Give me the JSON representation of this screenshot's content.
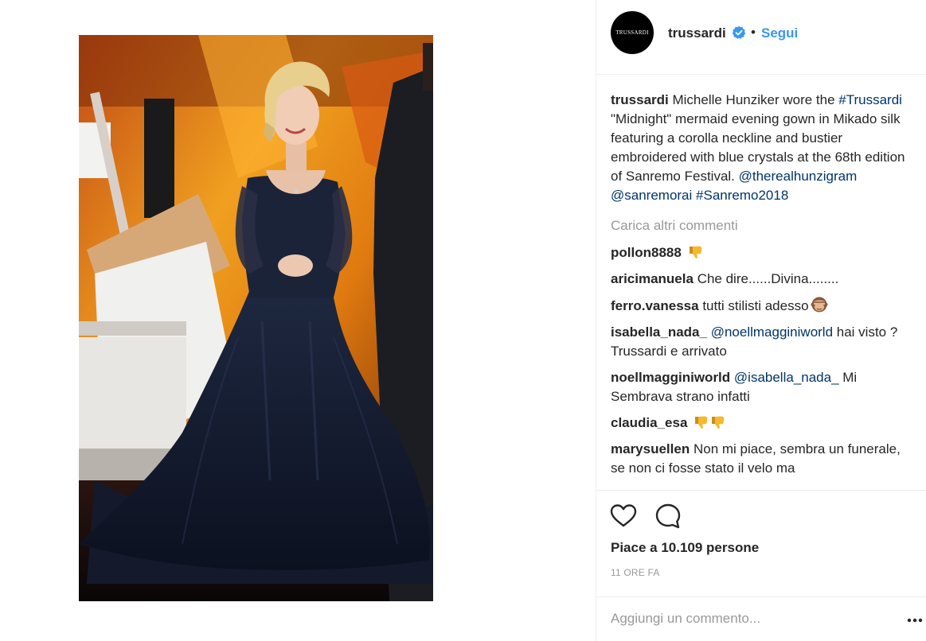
{
  "post": {
    "username": "trussardi",
    "avatar_text": "TRUSSARDI",
    "follow_label": "Segui",
    "separator": "•",
    "caption": {
      "username": "trussardi",
      "text1": " Michelle Hunziker wore the ",
      "hashtag1": "#Trussardi",
      "text2": " \"Midnight\" mermaid evening gown in Mikado silk featuring a corolla neckline and bustier embroidered with blue crystals at the 68th edition of Sanremo Festival. ",
      "mention1": "@therealhunzigram",
      "text3": " ",
      "mention2": "@sanremorai",
      "text4": " ",
      "hashtag2": "#Sanremo2018"
    },
    "load_more": "Carica altri commenti",
    "comments": [
      {
        "user": "pollon8888",
        "text": ""
      },
      {
        "user": "aricimanuela",
        "text": "Che dire......Divina........"
      },
      {
        "user": "ferro.vanessa",
        "text": "tutti stilisti adesso"
      },
      {
        "user": "isabella_nada_",
        "mention": "@noellmagginiworld",
        "text": " hai visto ? Trussardi e arrivato"
      },
      {
        "user": "noellmagginiworld",
        "mention": "@isabella_nada_",
        "text": " Mi Sembrava strano infatti"
      },
      {
        "user": "claudia_esa",
        "text": ""
      },
      {
        "user": "marysuellen",
        "text": "Non mi piace, sembra un funerale, se non ci fosse stato il velo ma"
      }
    ],
    "likes": "Piace a 10.109 persone",
    "time": "11 ORE FA",
    "add_comment_placeholder": "Aggiungi un commento..."
  },
  "icons": {
    "verified": "verified-badge-icon",
    "like": "heart-icon",
    "comment": "comment-bubble-icon",
    "more": "more-options-icon",
    "thumbs_down": "thumbs-down-emoji",
    "see_no_evil": "see-no-evil-monkey-emoji"
  },
  "colors": {
    "link": "#3897f0",
    "hashtag": "#003569",
    "muted": "#999999",
    "text": "#262626",
    "gown": "#1a2338"
  }
}
